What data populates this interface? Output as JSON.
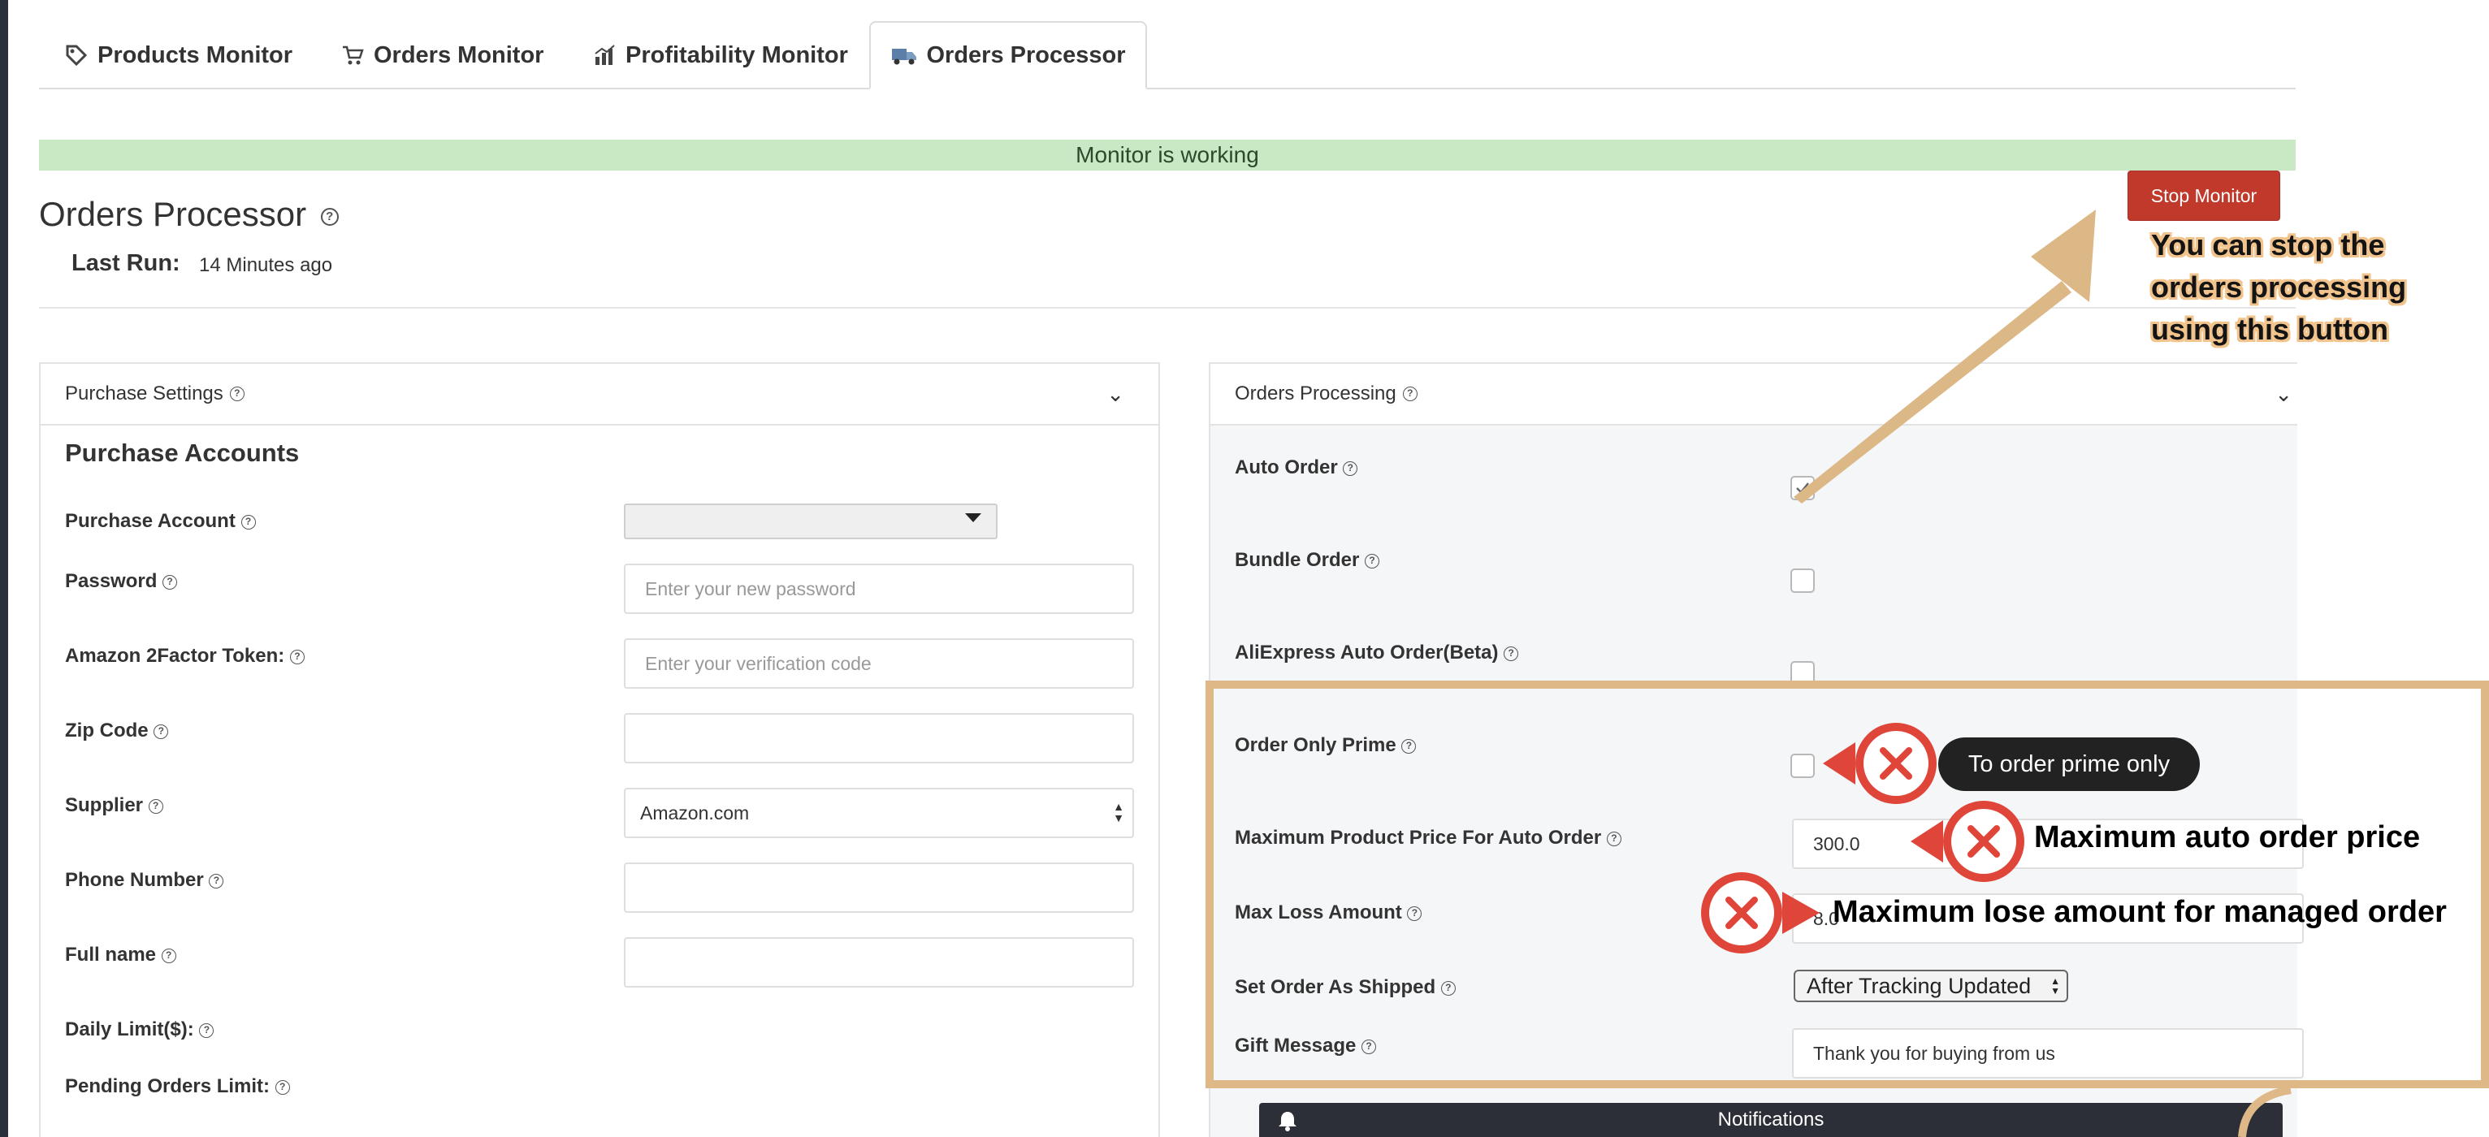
{
  "tabs": [
    {
      "label": "Products Monitor",
      "icon": "tag-icon"
    },
    {
      "label": "Orders Monitor",
      "icon": "cart-icon"
    },
    {
      "label": "Profitability Monitor",
      "icon": "chart-icon"
    },
    {
      "label": "Orders Processor",
      "icon": "truck-icon",
      "active": true
    }
  ],
  "banner": "Monitor is working",
  "stop_button": "Stop Monitor",
  "page_title": "Orders Processor",
  "last_run": {
    "label": "Last Run:",
    "value": "14 Minutes ago"
  },
  "purchase_settings": {
    "header": "Purchase Settings",
    "section": "Purchase Accounts",
    "fields": [
      {
        "label": "Purchase Account",
        "value": "",
        "placeholder": ""
      },
      {
        "label": "Password",
        "value": "",
        "placeholder": "Enter your new password"
      },
      {
        "label": "Amazon 2Factor Token:",
        "value": "",
        "placeholder": "Enter your verification code"
      },
      {
        "label": "Zip Code",
        "value": "",
        "placeholder": ""
      },
      {
        "label": "Supplier",
        "value": "Amazon.com",
        "placeholder": ""
      },
      {
        "label": "Phone Number",
        "value": "",
        "placeholder": ""
      },
      {
        "label": "Full name",
        "value": "",
        "placeholder": ""
      },
      {
        "label": "Daily Limit($):",
        "value": "",
        "placeholder": ""
      },
      {
        "label": "Pending Orders Limit:",
        "value": "",
        "placeholder": ""
      }
    ]
  },
  "orders_processing": {
    "header": "Orders Processing",
    "auto_order": {
      "label": "Auto Order",
      "checked": true
    },
    "bundle_order": {
      "label": "Bundle Order",
      "checked": false
    },
    "aliexpress": {
      "label": "AliExpress Auto Order(Beta)",
      "checked": false
    },
    "prime_only": {
      "label": "Order Only Prime",
      "checked": false
    },
    "max_price": {
      "label": "Maximum Product Price For Auto Order",
      "value": "300.0"
    },
    "max_loss": {
      "label": "Max Loss Amount",
      "value": "8.0"
    },
    "shipped": {
      "label": "Set Order As Shipped",
      "value": "After Tracking Updated"
    },
    "gift": {
      "label": "Gift Message",
      "value": "Thank you for buying from us"
    }
  },
  "annotations": {
    "stop_callout_1": "You can stop the",
    "stop_callout_2": "orders processing",
    "stop_callout_3": "using this button",
    "prime_tip": "To order prime only",
    "max_price_tip": "Maximum auto order price",
    "max_loss_tip": "Maximum lose amount for managed order"
  },
  "notifications": "Notifications",
  "colors": {
    "stop": "#c0392b",
    "banner": "#c9e8c4",
    "highlight": "#deb887",
    "error_marker": "#e0453a"
  }
}
